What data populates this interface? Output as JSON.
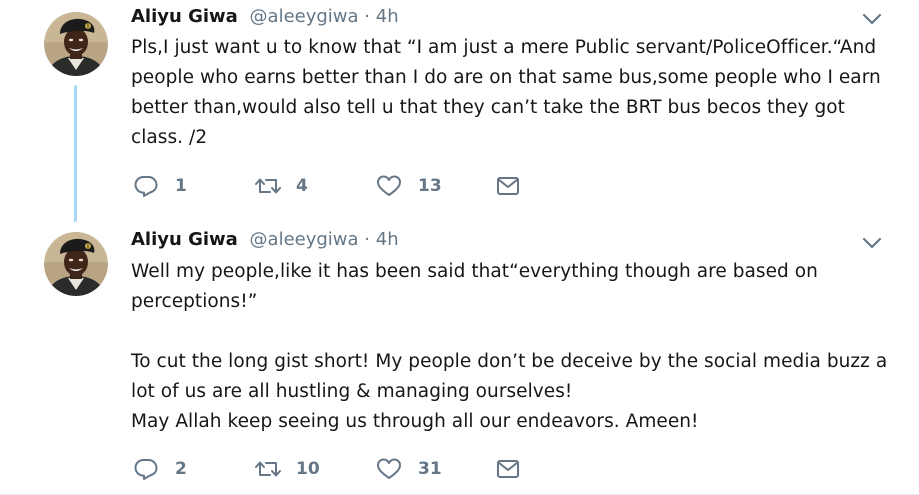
{
  "colors": {
    "text": "#14171a",
    "muted": "#657786",
    "thread_line": "#a7d8f4",
    "border": "#e6ecf0"
  },
  "tweets": [
    {
      "author_name": "Aliyu Giwa",
      "handle": "@aleeygiwa",
      "separator": "·",
      "time": "4h",
      "paragraphs": [
        "Pls,I just want u to know that “I am just a mere Public servant/PoliceOfficer.“And people who earns better than I do are on that same bus,some people who I earn better than,would also tell u that they can’t take the BRT bus becos they got class. /2"
      ],
      "replies": "1",
      "retweets": "4",
      "likes": "13",
      "icons": [
        "reply-icon",
        "retweet-icon",
        "like-icon",
        "direct-message-icon",
        "chevron-down-icon"
      ]
    },
    {
      "author_name": "Aliyu Giwa",
      "handle": "@aleeygiwa",
      "separator": "·",
      "time": "4h",
      "paragraphs": [
        "Well my people,like it has been said that“everything though are based on perceptions!”",
        "To cut the long gist short! My people don’t be deceive by the social media buzz a lot of us are all hustling & managing ourselves!",
        "May Allah keep seeing us through all our endeavors. Ameen!"
      ],
      "replies": "2",
      "retweets": "10",
      "likes": "31",
      "icons": [
        "reply-icon",
        "retweet-icon",
        "like-icon",
        "direct-message-icon",
        "chevron-down-icon"
      ]
    }
  ]
}
